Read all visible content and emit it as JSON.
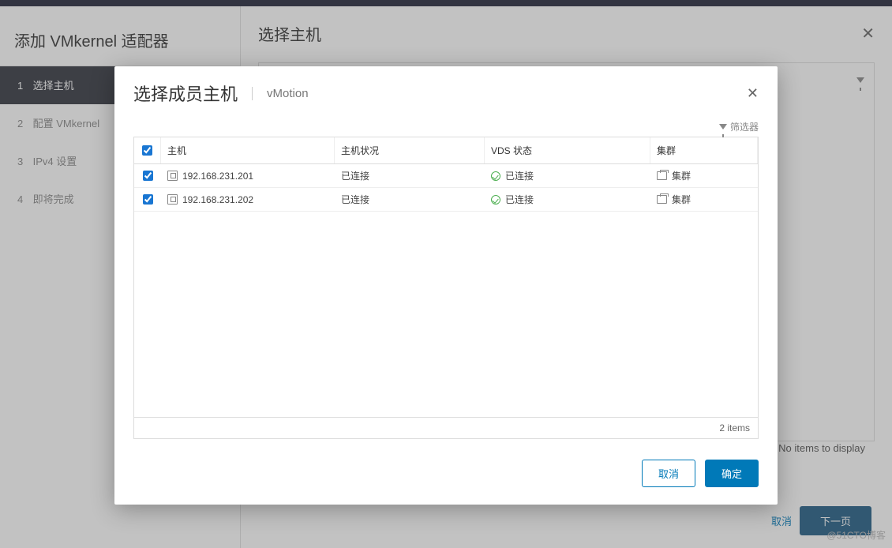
{
  "wizard": {
    "title": "添加 VMkernel 适配器",
    "steps": [
      {
        "num": "1",
        "label": "选择主机",
        "active": true
      },
      {
        "num": "2",
        "label": "配置 VMkernel",
        "active": false
      },
      {
        "num": "3",
        "label": "IPv4 设置",
        "active": false
      },
      {
        "num": "4",
        "label": "即将完成",
        "active": false
      }
    ],
    "main_title": "选择主机",
    "no_items": "No items to display",
    "cancel": "取消",
    "next": "下一页"
  },
  "modal": {
    "title": "选择成员主机",
    "subtitle": "vMotion",
    "filter_label": "筛选器",
    "columns": {
      "host": "主机",
      "host_state": "主机状况",
      "vds_state": "VDS 状态",
      "cluster": "集群"
    },
    "rows": [
      {
        "checked": true,
        "host": "192.168.231.201",
        "host_state": "已连接",
        "vds_state": "已连接",
        "cluster": "集群"
      },
      {
        "checked": true,
        "host": "192.168.231.202",
        "host_state": "已连接",
        "vds_state": "已连接",
        "cluster": "集群"
      }
    ],
    "items_count": "2 items",
    "cancel": "取消",
    "ok": "确定"
  },
  "watermark": "@51CTO博客"
}
